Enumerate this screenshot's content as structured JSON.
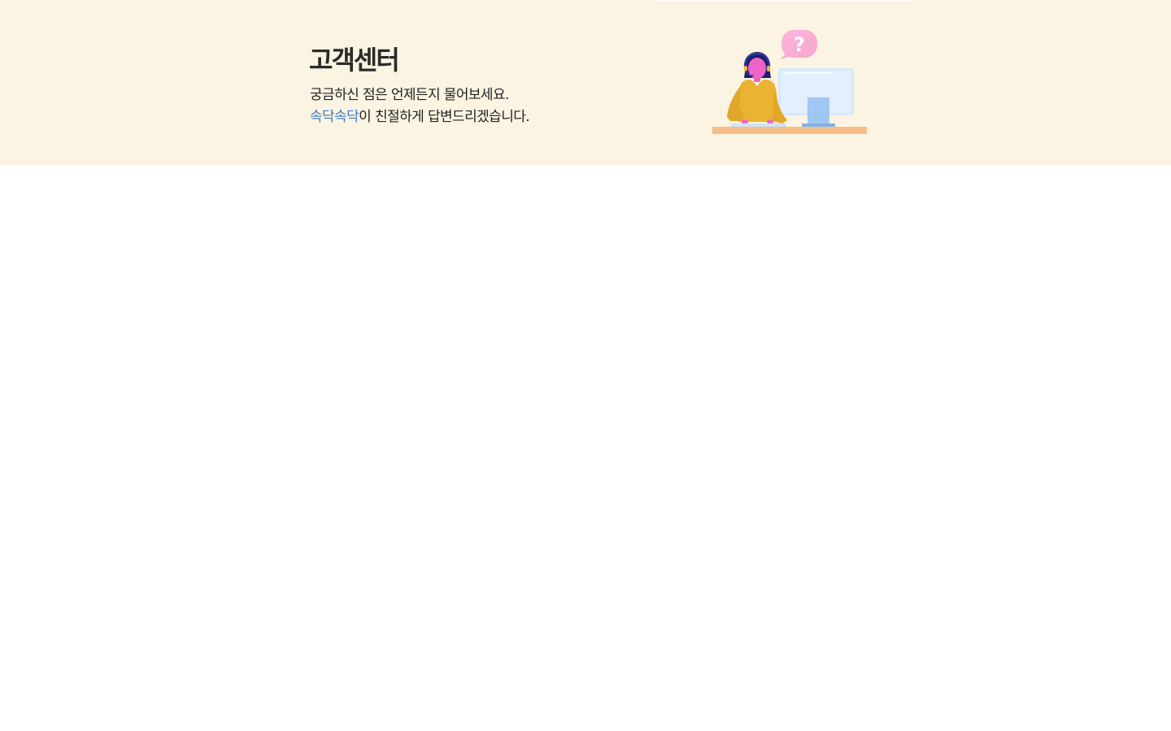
{
  "header": {
    "title": "고객센터",
    "line1": "궁금하신 점은 언제든지 물어보세요.",
    "line2_highlight": "속닥속닥",
    "line2_rest": "이 친절하게 답변드리겠습니다."
  },
  "illustration": {
    "bubble_text": "?",
    "icon": "customer-support-agent-illustration"
  },
  "colors": {
    "hero_background": "#fcf4e2",
    "highlight": "#3b78c4",
    "title": "#2b2b2b"
  }
}
